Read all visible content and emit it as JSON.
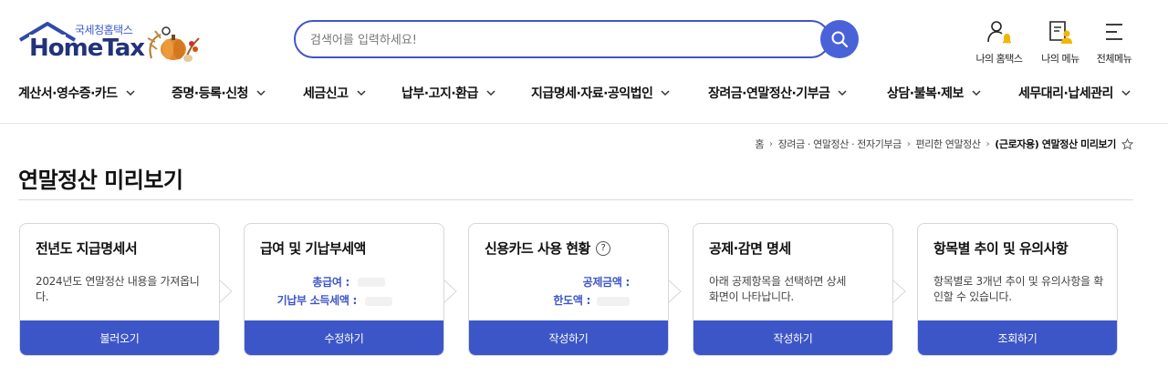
{
  "logo": {
    "sub_text": "국세청홈택스",
    "main_text": "HomeTax"
  },
  "search": {
    "placeholder": "검색어를 입력하세요!"
  },
  "utility": [
    {
      "label": "나의 홈택스",
      "icon": "user-bell-icon"
    },
    {
      "label": "나의 메뉴",
      "icon": "book-user-icon"
    },
    {
      "label": "전체메뉴",
      "icon": "hamburger-menu-icon"
    }
  ],
  "nav": [
    {
      "label": "계산서·영수증·카드"
    },
    {
      "label": "증명·등록·신청"
    },
    {
      "label": "세금신고"
    },
    {
      "label": "납부·고지·환급"
    },
    {
      "label": "지급명세·자료·공익법인"
    },
    {
      "label": "장려금·연말정산·기부금"
    },
    {
      "label": "상담·불복·제보"
    },
    {
      "label": "세무대리·납세관리"
    }
  ],
  "breadcrumb": {
    "items": [
      "홈",
      "장려금 · 연말정산 · 전자기부금",
      "편리한 연말정산"
    ],
    "current": "(근로자용) 연말정산 미리보기"
  },
  "page_title": "연말정산 미리보기",
  "cards": [
    {
      "title": "전년도 지급명세서",
      "desc": "2024년도 연말정산 내용을 가져옵니다.",
      "button": "불러오기"
    },
    {
      "title": "급여 및 기납부세액",
      "fields": [
        "총급여 :",
        "기납부 소득세액 :"
      ],
      "button": "수정하기"
    },
    {
      "title": "신용카드 사용 현황",
      "help": "?",
      "fields": [
        "공제금액 :",
        "한도액 :"
      ],
      "button": "작성하기"
    },
    {
      "title": "공제·감면 명세",
      "desc": "아래 공제항목을 선택하면 상세화면이 나타납니다.",
      "button": "작성하기"
    },
    {
      "title": "항목별 추이 및 유의사항",
      "desc": "항목별로 3개년 추이 및 유의사항을 확인할 수 있습니다.",
      "button": "조회하기"
    }
  ],
  "colors": {
    "primary": "#3d56c7",
    "brand_dark": "#22337a",
    "accent_text": "#3d56c7"
  }
}
